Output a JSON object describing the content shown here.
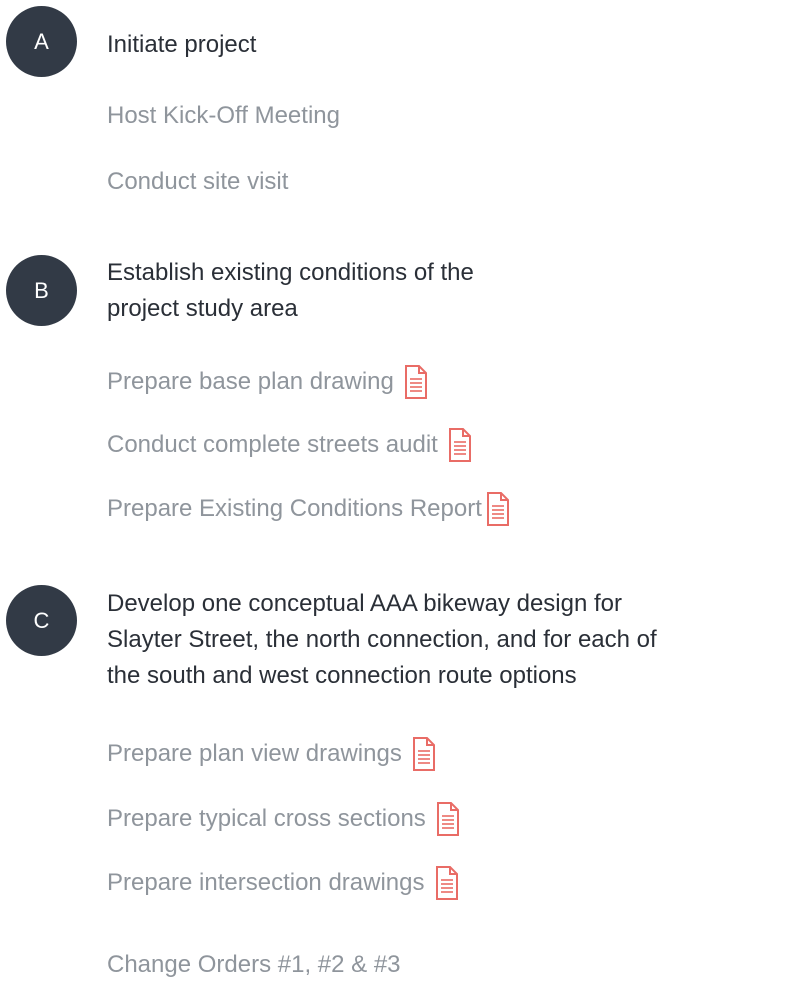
{
  "accent_color": "#e96c66",
  "badge_color": "#323a46",
  "sections": [
    {
      "letter": "A",
      "heading_lines": [
        "Initiate project"
      ],
      "items": [
        {
          "label": "Host Kick-Off Meeting",
          "icon": "document-icon",
          "has_icon": false
        },
        {
          "label": "Conduct site visit",
          "icon": "document-icon",
          "has_icon": false
        }
      ]
    },
    {
      "letter": "B",
      "heading_lines": [
        "Establish existing conditions of the",
        "project study area"
      ],
      "items": [
        {
          "label": "Prepare base plan drawing",
          "icon": "document-icon",
          "has_icon": true
        },
        {
          "label": "Conduct complete streets audit",
          "icon": "document-icon",
          "has_icon": true
        },
        {
          "label": "Prepare Existing Conditions Report",
          "icon": "document-icon",
          "has_icon": true
        }
      ]
    },
    {
      "letter": "C",
      "heading_lines": [
        "Develop one conceptual AAA bikeway design for",
        "Slayter Street, the north connection, and for each of",
        "the south and west connection route options"
      ],
      "items": [
        {
          "label": "Prepare plan view drawings",
          "icon": "document-icon",
          "has_icon": true
        },
        {
          "label": "Prepare typical cross sections",
          "icon": "document-icon",
          "has_icon": true
        },
        {
          "label": "Prepare intersection drawings",
          "icon": "document-icon",
          "has_icon": true
        }
      ]
    }
  ],
  "footer_link": "Change Orders #1, #2 & #3"
}
